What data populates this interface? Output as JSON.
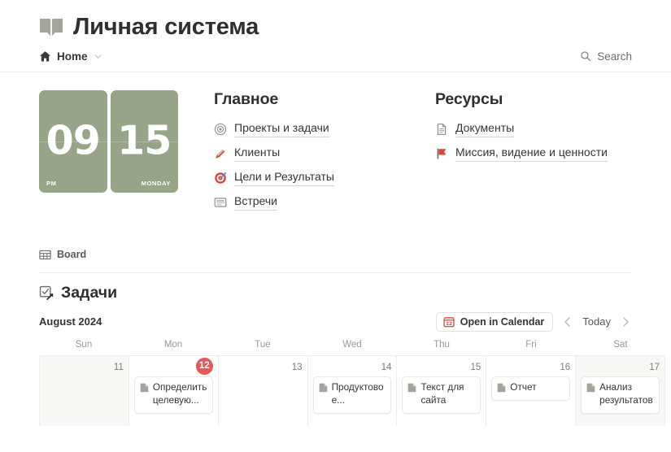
{
  "header": {
    "icon": "open-book-icon",
    "title": "Личная система"
  },
  "breadcrumb": {
    "home_icon": "home-icon",
    "home_label": "Home",
    "chevron_icon": "chevron-down-icon"
  },
  "search": {
    "icon": "search-icon",
    "label": "Search"
  },
  "clock": {
    "hours": "09",
    "minutes": "15",
    "meridiem": "PM",
    "weekday": "MONDAY",
    "color": "#97a487"
  },
  "columns": [
    {
      "title": "Главное",
      "links": [
        {
          "icon": "record-circle-icon",
          "label": "Проекты и задачи"
        },
        {
          "icon": "pen-nib-icon",
          "label": "Клиенты"
        },
        {
          "icon": "dart-target-icon",
          "label": "Цели и Результаты"
        },
        {
          "icon": "note-card-icon",
          "label": "Встречи"
        }
      ]
    },
    {
      "title": "Ресурсы",
      "links": [
        {
          "icon": "page-document-icon",
          "label": "Документы"
        },
        {
          "icon": "red-flag-icon",
          "label": "Миссия, видение и ценности"
        }
      ]
    }
  ],
  "board": {
    "icon": "table-view-icon",
    "label": "Board"
  },
  "database": {
    "icon": "linked-checkbox-icon",
    "title": "Задачи"
  },
  "calendar": {
    "month_label": "August 2024",
    "open_button": {
      "icon": "calendar-12-icon",
      "label": "Open in Calendar"
    },
    "prev_icon": "chevron-left-icon",
    "today_label": "Today",
    "next_icon": "chevron-right-icon",
    "weekdays": [
      "Sun",
      "Mon",
      "Tue",
      "Wed",
      "Thu",
      "Fri",
      "Sat"
    ],
    "today_accent": "#eb5757",
    "days": [
      {
        "number": "11",
        "is_today": false,
        "dim": true,
        "cards": []
      },
      {
        "number": "12",
        "is_today": true,
        "dim": false,
        "cards": [
          {
            "icon": "page-icon",
            "text": "Определить целевую..."
          }
        ]
      },
      {
        "number": "13",
        "is_today": false,
        "dim": false,
        "cards": []
      },
      {
        "number": "14",
        "is_today": false,
        "dim": false,
        "cards": [
          {
            "icon": "page-icon",
            "text": "Продуктовое..."
          }
        ]
      },
      {
        "number": "15",
        "is_today": false,
        "dim": false,
        "cards": [
          {
            "icon": "page-icon",
            "text": "Текст для сайта"
          }
        ]
      },
      {
        "number": "16",
        "is_today": false,
        "dim": false,
        "cards": [
          {
            "icon": "page-icon",
            "text": "Отчет"
          }
        ]
      },
      {
        "number": "17",
        "is_today": false,
        "dim": true,
        "cards": [
          {
            "icon": "page-icon",
            "text": "Анализ результатов"
          }
        ]
      }
    ]
  }
}
